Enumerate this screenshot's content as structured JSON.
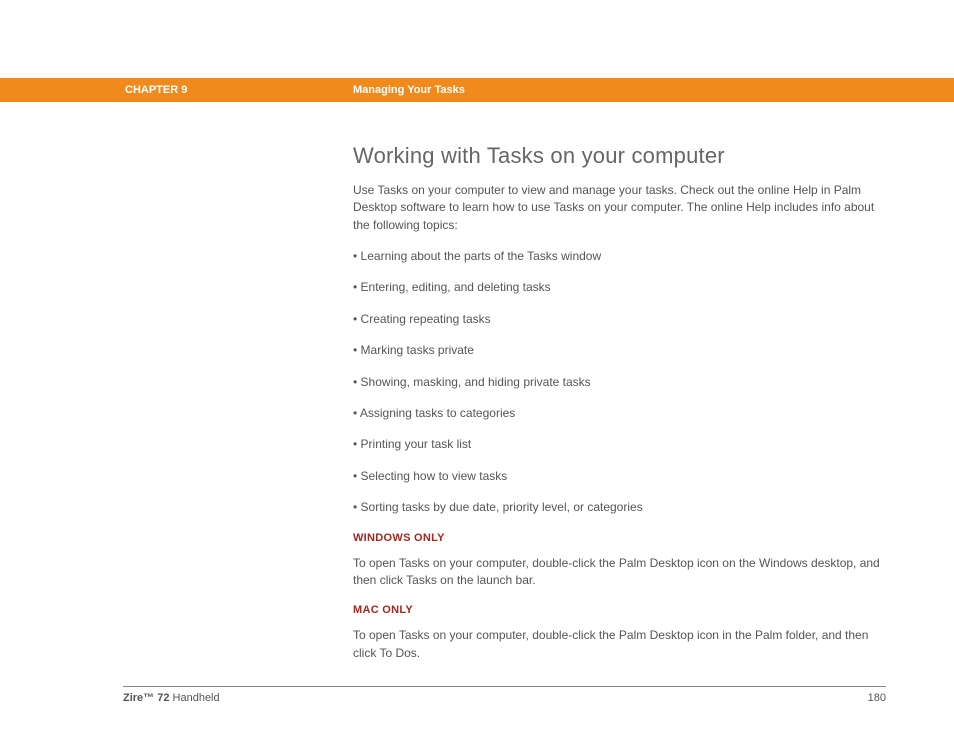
{
  "header": {
    "chapter": "CHAPTER 9",
    "section": "Managing Your Tasks"
  },
  "main": {
    "title": "Working with Tasks on your computer",
    "intro": "Use Tasks on your computer to view and manage your tasks. Check out the online Help in Palm Desktop software to learn how to use Tasks on your computer. The online Help includes info about the following topics:",
    "bullets": [
      "Learning about the parts of the Tasks window",
      "Entering, editing, and deleting tasks",
      "Creating repeating tasks",
      "Marking tasks private",
      "Showing, masking, and hiding private tasks",
      "Assigning tasks to categories",
      "Printing your task list",
      "Selecting how to view tasks",
      "Sorting tasks by due date, priority level, or categories"
    ],
    "windows_label": "WINDOWS ONLY",
    "windows_text": "To open Tasks on your computer, double-click the Palm Desktop icon on the Windows desktop, and then click Tasks on the launch bar.",
    "mac_label": "MAC ONLY",
    "mac_text": "To open Tasks on your computer, double-click the Palm Desktop icon in the Palm folder, and then click To Dos."
  },
  "footer": {
    "product_bold": "Zire™ 72",
    "product_rest": " Handheld",
    "page": "180"
  }
}
